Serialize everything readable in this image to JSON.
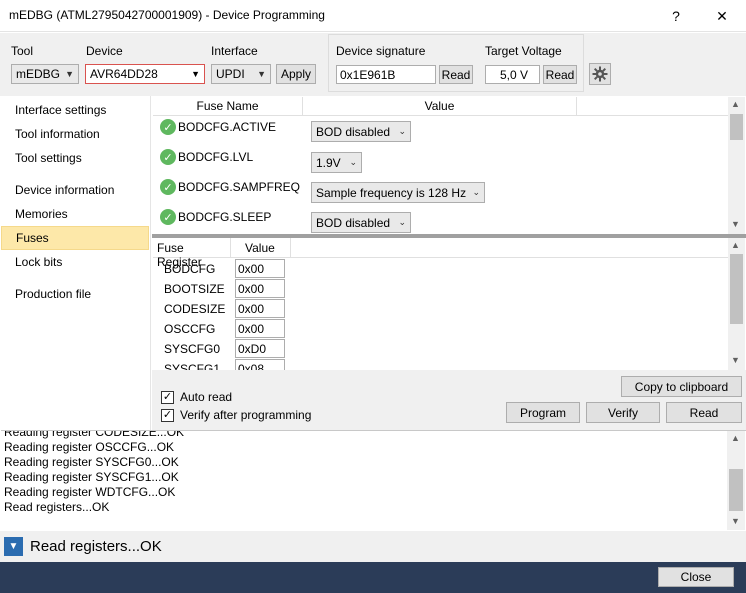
{
  "window": {
    "title": "mEDBG (ATML2795042700001909) - Device Programming",
    "help_label": "?",
    "close_label": "✕"
  },
  "toolbar": {
    "tool_label": "Tool",
    "tool_value": "mEDBG",
    "device_label": "Device",
    "device_value": "AVR64DD28",
    "interface_label": "Interface",
    "interface_value": "UPDI",
    "apply_label": "Apply",
    "signature_label": "Device signature",
    "signature_value": "0x1E961B",
    "signature_read_label": "Read",
    "voltage_label": "Target Voltage",
    "voltage_value": "5,0 V",
    "voltage_read_label": "Read"
  },
  "sidebar": {
    "items": [
      {
        "label": "Interface settings"
      },
      {
        "label": "Tool information"
      },
      {
        "label": "Tool settings"
      },
      {
        "label": "Device information"
      },
      {
        "label": "Memories"
      },
      {
        "label": "Fuses"
      },
      {
        "label": "Lock bits"
      },
      {
        "label": "Production file"
      }
    ],
    "active": "Fuses"
  },
  "fuse_grid": {
    "col_name": "Fuse Name",
    "col_value": "Value",
    "rows": [
      {
        "name": "BODCFG.ACTIVE",
        "value": "BOD disabled"
      },
      {
        "name": "BODCFG.LVL",
        "value": "1.9V"
      },
      {
        "name": "BODCFG.SAMPFREQ",
        "value": "Sample frequency is 128 Hz"
      },
      {
        "name": "BODCFG.SLEEP",
        "value": "BOD disabled"
      }
    ]
  },
  "register_grid": {
    "col_register": "Fuse Register",
    "col_value": "Value",
    "rows": [
      {
        "name": "BODCFG",
        "value": "0x00"
      },
      {
        "name": "BOOTSIZE",
        "value": "0x00"
      },
      {
        "name": "CODESIZE",
        "value": "0x00"
      },
      {
        "name": "OSCCFG",
        "value": "0x00"
      },
      {
        "name": "SYSCFG0",
        "value": "0xD0"
      },
      {
        "name": "SYSCFG1",
        "value": "0x08"
      }
    ]
  },
  "options": {
    "auto_read_label": "Auto read",
    "auto_read_checked": true,
    "verify_label": "Verify after programming",
    "verify_checked": true
  },
  "actions": {
    "copy_label": "Copy to clipboard",
    "program_label": "Program",
    "verify_label": "Verify",
    "read_label": "Read"
  },
  "log": {
    "lines": [
      "Reading register CODESIZE...OK",
      "Reading register OSCCFG...OK",
      "Reading register SYSCFG0...OK",
      "Reading register SYSCFG1...OK",
      "Reading register WDTCFG...OK",
      "Read registers...OK"
    ]
  },
  "status": {
    "text": "Read registers...OK"
  },
  "footer": {
    "close_label": "Close"
  },
  "colors": {
    "active_nav": "#fde8a9",
    "footer_bg": "#2b3c58",
    "status_expander": "#2b6cb0",
    "ok_icon": "#5fb85f"
  }
}
